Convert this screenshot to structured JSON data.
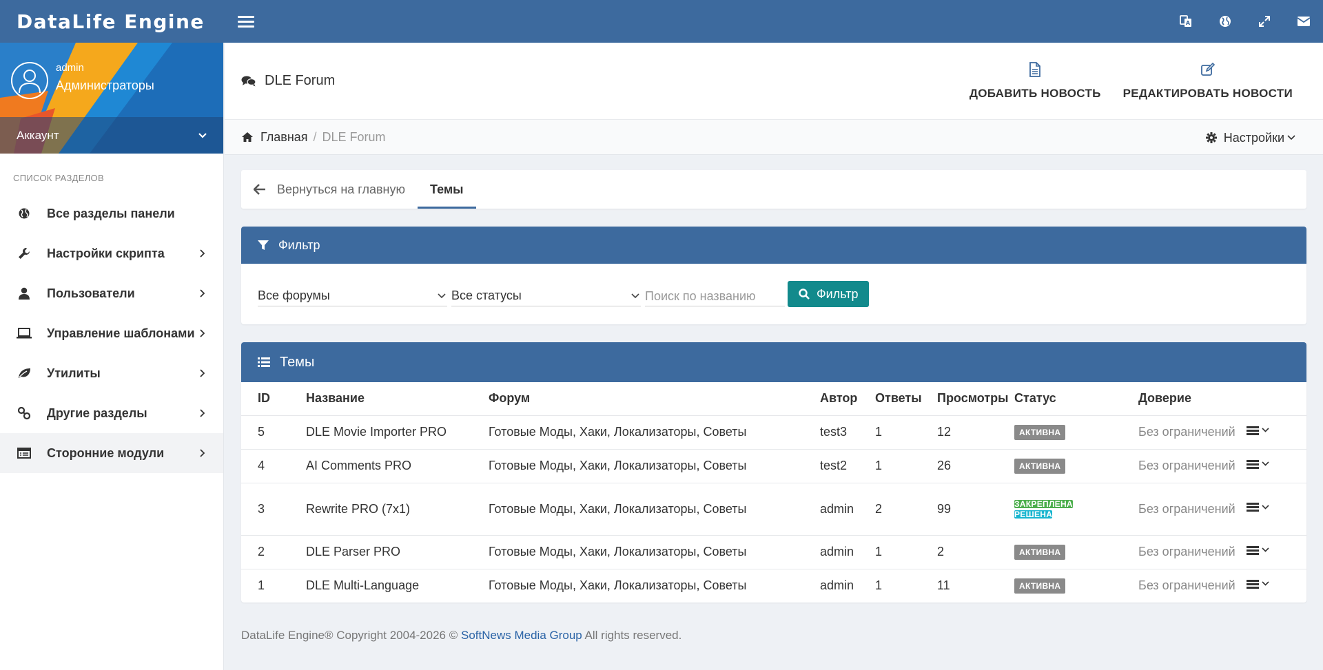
{
  "brand": "DataLife Engine",
  "user": {
    "name": "admin",
    "group": "Администраторы",
    "account_label": "Аккаунт"
  },
  "sidebar": {
    "heading": "СПИСОК РАЗДЕЛОВ",
    "items": [
      {
        "label": "Все разделы панели",
        "icon": "globe-icon"
      },
      {
        "label": "Настройки скрипта",
        "icon": "wrench-icon"
      },
      {
        "label": "Пользователи",
        "icon": "user-icon"
      },
      {
        "label": "Управление шаблонами",
        "icon": "laptop-icon"
      },
      {
        "label": "Утилиты",
        "icon": "leaf-icon"
      },
      {
        "label": "Другие разделы",
        "icon": "link-icon"
      },
      {
        "label": "Сторонние модули",
        "icon": "module-list-icon"
      }
    ]
  },
  "header": {
    "title": "DLE Forum",
    "actions": [
      {
        "label": "ДОБАВИТЬ НОВОСТЬ",
        "icon": "file-icon"
      },
      {
        "label": "РЕДАКТИРОВАТЬ НОВОСТИ",
        "icon": "edit-icon"
      }
    ]
  },
  "breadcrumb": {
    "home": "Главная",
    "separator": "/",
    "current": "DLE Forum"
  },
  "settings_label": "Настройки",
  "tabs": {
    "back": "Вернуться на главную",
    "active": "Темы"
  },
  "filter": {
    "title": "Фильтр",
    "forum_select": "Все форумы",
    "status_select": "Все статусы",
    "search_placeholder": "Поиск по названию",
    "button": "Фильтр"
  },
  "topics": {
    "title": "Темы",
    "columns": [
      "ID",
      "Название",
      "Форум",
      "Автор",
      "Ответы",
      "Просмотры",
      "Статус",
      "Доверие"
    ],
    "rows": [
      {
        "id": "5",
        "name": "DLE Movie Importer PRO",
        "forum": "Готовые Моды, Хаки, Локализаторы, Советы",
        "author": "test3",
        "replies": "1",
        "views": "12",
        "status": [
          "АКТИВНА"
        ],
        "trust": "Без ограничений"
      },
      {
        "id": "4",
        "name": "AI Comments PRO",
        "forum": "Готовые Моды, Хаки, Локализаторы, Советы",
        "author": "test2",
        "replies": "1",
        "views": "26",
        "status": [
          "АКТИВНА"
        ],
        "trust": "Без ограничений"
      },
      {
        "id": "3",
        "name": "Rewrite PRO (7x1)",
        "forum": "Готовые Моды, Хаки, Локализаторы, Советы",
        "author": "admin",
        "replies": "2",
        "views": "99",
        "status": [
          "ЗАКРЕПЛЕНА",
          "РЕШЕНА"
        ],
        "trust": "Без ограничений"
      },
      {
        "id": "2",
        "name": "DLE Parser PRO",
        "forum": "Готовые Моды, Хаки, Локализаторы, Советы",
        "author": "admin",
        "replies": "1",
        "views": "2",
        "status": [
          "АКТИВНА"
        ],
        "trust": "Без ограничений"
      },
      {
        "id": "1",
        "name": "DLE Multi-Language",
        "forum": "Готовые Моды, Хаки, Локализаторы, Советы",
        "author": "admin",
        "replies": "1",
        "views": "11",
        "status": [
          "АКТИВНА"
        ],
        "trust": "Без ограничений"
      }
    ]
  },
  "footer": {
    "prefix": "DataLife Engine® Copyright 2004-2026 ©",
    "link": "SoftNews Media Group",
    "suffix": "All rights reserved."
  },
  "colors": {
    "primary": "#3d6a9e",
    "teal_button": "#128a8c",
    "badge_active": "#8a8a8a",
    "badge_pinned": "#4cae4c",
    "badge_solved": "#17b5cf"
  }
}
